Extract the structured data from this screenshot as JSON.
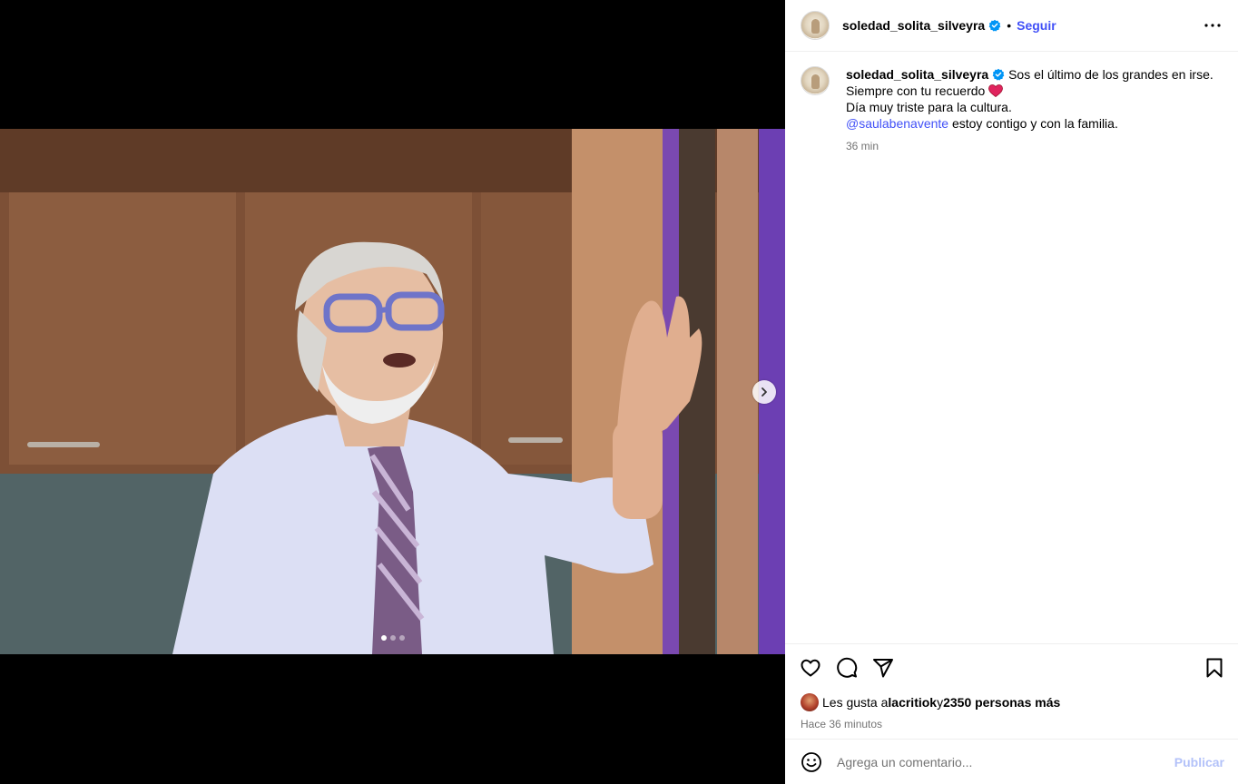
{
  "post": {
    "author": "soledad_solita_silveyra",
    "follow_label": "Seguir",
    "separator": "•",
    "caption_lines": [
      "Sos el último de los grandes en irse.",
      "Siempre con tu recuerdo",
      "Día muy triste para la cultura."
    ],
    "mention": "@saulabenavente",
    "mention_tail": " estoy contigo y con la familia.",
    "caption_time": "36 min",
    "likes_prefix": "Les gusta a ",
    "liker": "lacritiok",
    "likes_mid": " y ",
    "likes_count": "2350 personas más",
    "time_ago": "Hace 36 minutos"
  },
  "comment": {
    "placeholder": "Agrega un comentario...",
    "publish_label": "Publicar"
  },
  "carousel": {
    "slide_count": 3,
    "active_slide": 1
  },
  "icons": {
    "verified": "verified-badge-icon",
    "more": "more-options-icon",
    "like": "heart-icon",
    "comment": "comment-bubble-icon",
    "share": "paper-plane-icon",
    "save": "bookmark-icon",
    "emoji": "emoji-face-icon",
    "next": "chevron-right-icon"
  },
  "colors": {
    "link_blue": "#4150f7",
    "publish_disabled": "#b3c2f9",
    "verified_blue": "#0095f6",
    "heart_red": "#e0245e"
  }
}
